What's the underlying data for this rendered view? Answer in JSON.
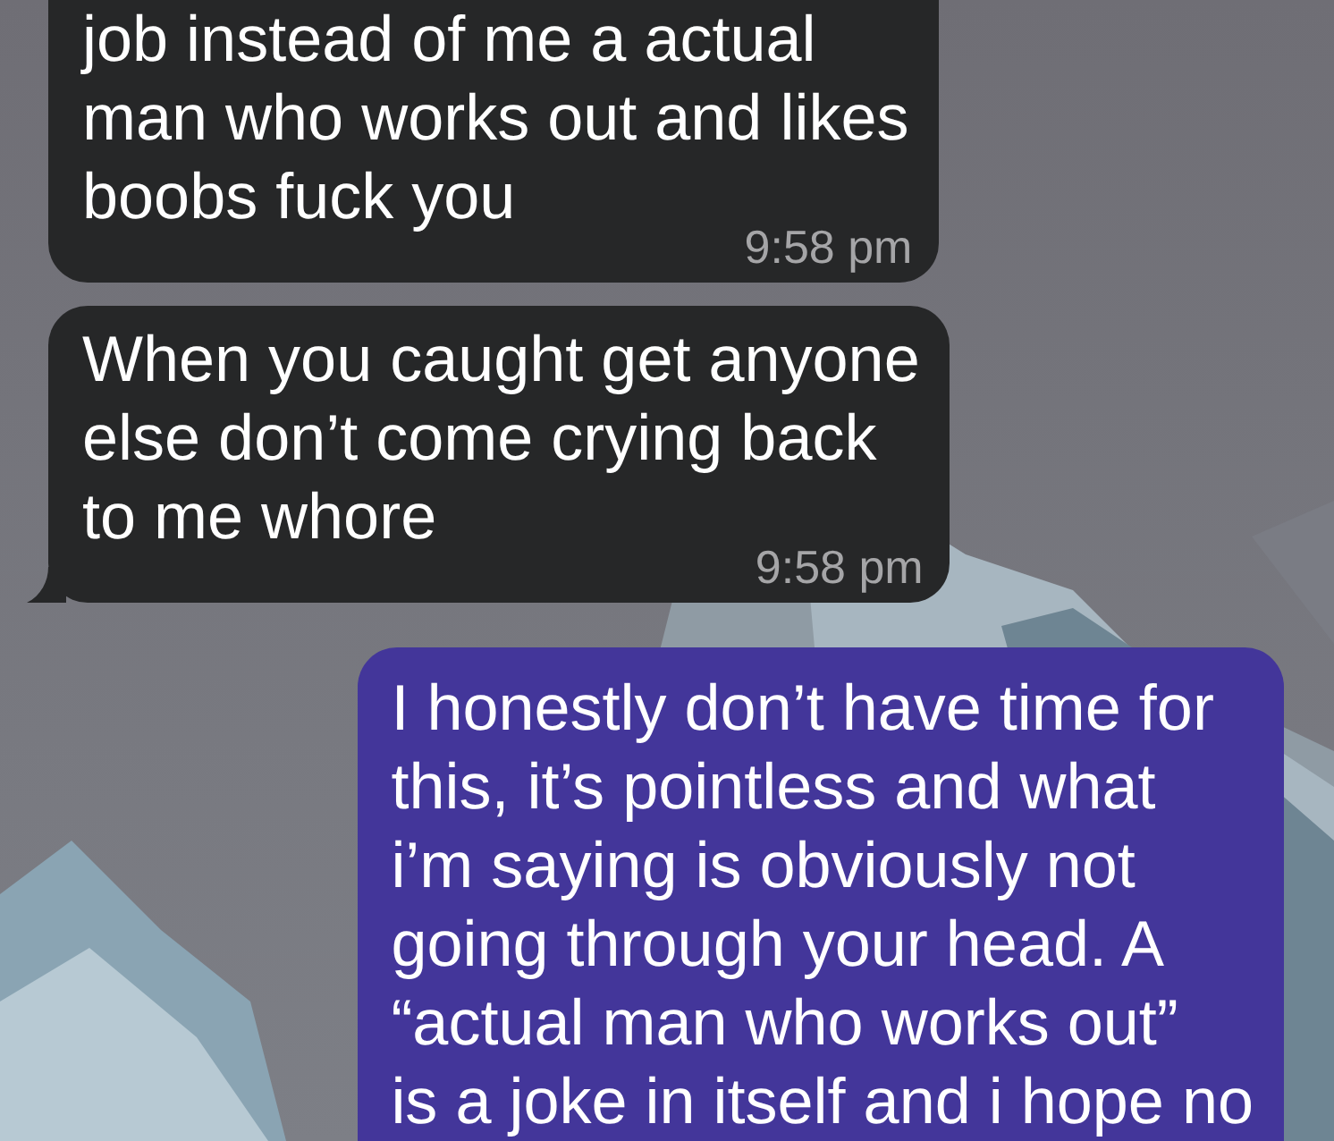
{
  "messages": [
    {
      "kind": "received",
      "text": "job instead of me a actual\nman who works out and likes\nboobs fuck you",
      "time": "9:58 pm",
      "tail": false
    },
    {
      "kind": "received",
      "text": "When you caught get anyone\nelse don’t come crying back\nto me whore",
      "time": "9:58 pm",
      "tail": true
    },
    {
      "kind": "sent",
      "text": "I honestly don’t have time for\nthis, it’s pointless and what\ni’m saying is obviously not\ngoing through your head. A\n“actual man who works out”\nis a joke in itself and i hope no",
      "tail": false
    }
  ]
}
